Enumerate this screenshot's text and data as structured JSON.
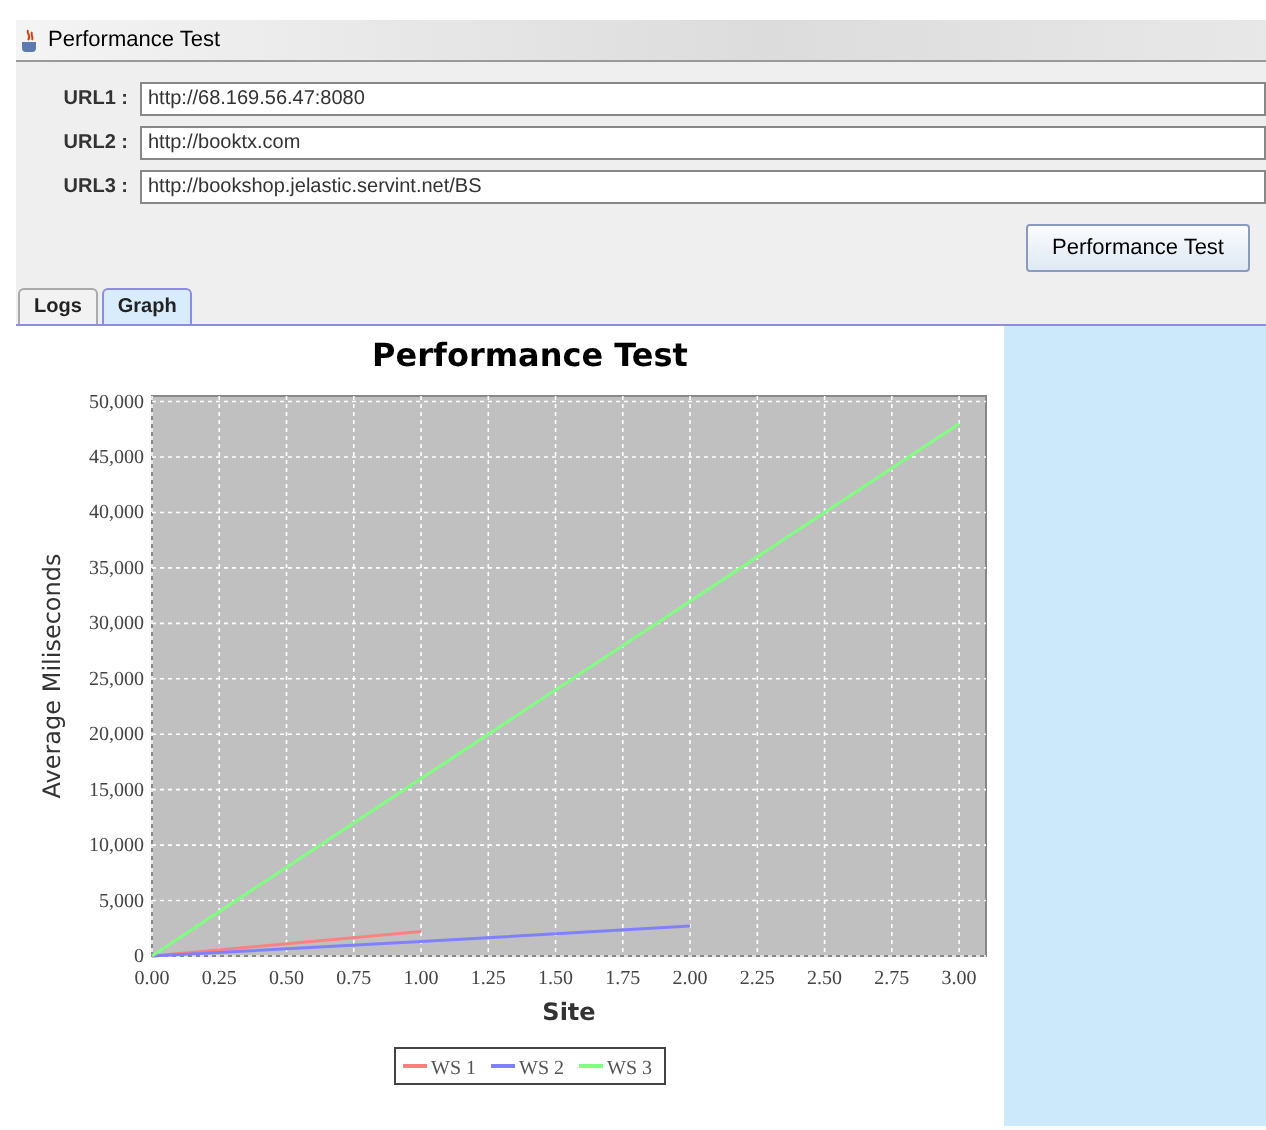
{
  "window": {
    "title": "Performance Test"
  },
  "urls": [
    {
      "label": "URL1 :",
      "value": "http://68.169.56.47:8080"
    },
    {
      "label": "URL2 :",
      "value": "http://booktx.com"
    },
    {
      "label": "URL3 :",
      "value": "http://bookshop.jelastic.servint.net/BS"
    }
  ],
  "run_button": "Performance Test",
  "tabs": [
    {
      "label": "Logs",
      "selected": false
    },
    {
      "label": "Graph",
      "selected": true
    }
  ],
  "chart": {
    "chart_data": {
      "type": "line",
      "grid": true,
      "legend": true,
      "title": "Performance Test",
      "xlabel": "Site",
      "ylabel": "Average Miliseconds",
      "xlim": [
        0,
        3.1
      ],
      "ylim": [
        0,
        50500
      ],
      "xticks": [
        {
          "value": 0,
          "label": "0.00"
        },
        {
          "value": 0.25,
          "label": "0.25"
        },
        {
          "value": 0.5,
          "label": "0.50"
        },
        {
          "value": 0.75,
          "label": "0.75"
        },
        {
          "value": 1,
          "label": "1.00"
        },
        {
          "value": 1.25,
          "label": "1.25"
        },
        {
          "value": 1.5,
          "label": "1.50"
        },
        {
          "value": 1.75,
          "label": "1.75"
        },
        {
          "value": 2,
          "label": "2.00"
        },
        {
          "value": 2.25,
          "label": "2.25"
        },
        {
          "value": 2.5,
          "label": "2.50"
        },
        {
          "value": 2.75,
          "label": "2.75"
        },
        {
          "value": 3,
          "label": "3.00"
        }
      ],
      "yticks": [
        {
          "value": 0,
          "label": "0"
        },
        {
          "value": 5000,
          "label": "5,000"
        },
        {
          "value": 10000,
          "label": "10,000"
        },
        {
          "value": 15000,
          "label": "15,000"
        },
        {
          "value": 20000,
          "label": "20,000"
        },
        {
          "value": 25000,
          "label": "25,000"
        },
        {
          "value": 30000,
          "label": "30,000"
        },
        {
          "value": 35000,
          "label": "35,000"
        },
        {
          "value": 40000,
          "label": "40,000"
        },
        {
          "value": 45000,
          "label": "45,000"
        },
        {
          "value": 50000,
          "label": "50,000"
        }
      ],
      "x": [
        0,
        1,
        2,
        3
      ],
      "series": [
        {
          "name": "WS 1",
          "color": "#ff8080",
          "values": [
            0,
            2200,
            null,
            null
          ]
        },
        {
          "name": "WS 2",
          "color": "#8080ff",
          "values": [
            0,
            1300,
            2700,
            null
          ]
        },
        {
          "name": "WS 3",
          "color": "#80ff80",
          "values": [
            0,
            16000,
            32000,
            48000
          ]
        }
      ]
    }
  }
}
